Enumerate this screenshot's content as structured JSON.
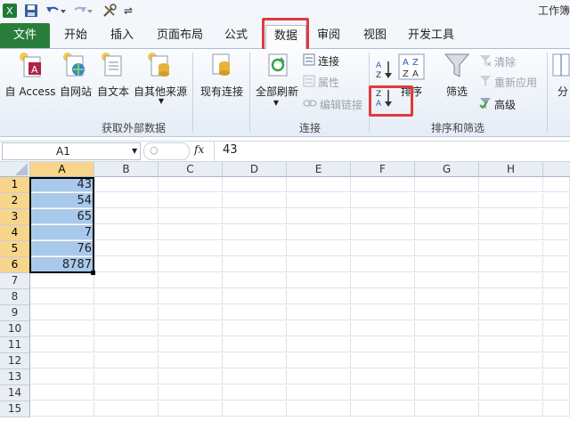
{
  "app": {
    "title": "工作簿"
  },
  "quick_access": {
    "customize_symbol": "⇌"
  },
  "tabs": [
    "文件",
    "开始",
    "插入",
    "页面布局",
    "公式",
    "数据",
    "审阅",
    "视图",
    "开发工具"
  ],
  "ribbon": {
    "get_external": {
      "buttons": [
        "自 Access",
        "自网站",
        "自文本",
        "自其他来源",
        "现有连接"
      ],
      "label": "获取外部数据"
    },
    "connections": {
      "refresh_all": "全部刷新",
      "links": [
        "连接",
        "属性",
        "编辑链接"
      ],
      "label": "连接"
    },
    "sort_filter": {
      "sort": "排序",
      "filter": "筛选",
      "options": [
        "清除",
        "重新应用",
        "高级"
      ],
      "label": "排序和筛选"
    },
    "more": "分"
  },
  "formula_bar": {
    "cell_ref": "A1",
    "fx": "fx",
    "value": "43"
  },
  "columns": [
    "A",
    "B",
    "C",
    "D",
    "E",
    "F",
    "G",
    "H"
  ],
  "rows": [
    "1",
    "2",
    "3",
    "4",
    "5",
    "6",
    "7",
    "8",
    "9",
    "10",
    "11",
    "12",
    "13",
    "14",
    "15"
  ],
  "cells_a": [
    "43",
    "54",
    "65",
    "7",
    "76",
    "8787"
  ],
  "colors": {
    "file_tab": "#2a7e3c",
    "highlight": "#e23a3a",
    "selection": "#a9c9ec"
  }
}
